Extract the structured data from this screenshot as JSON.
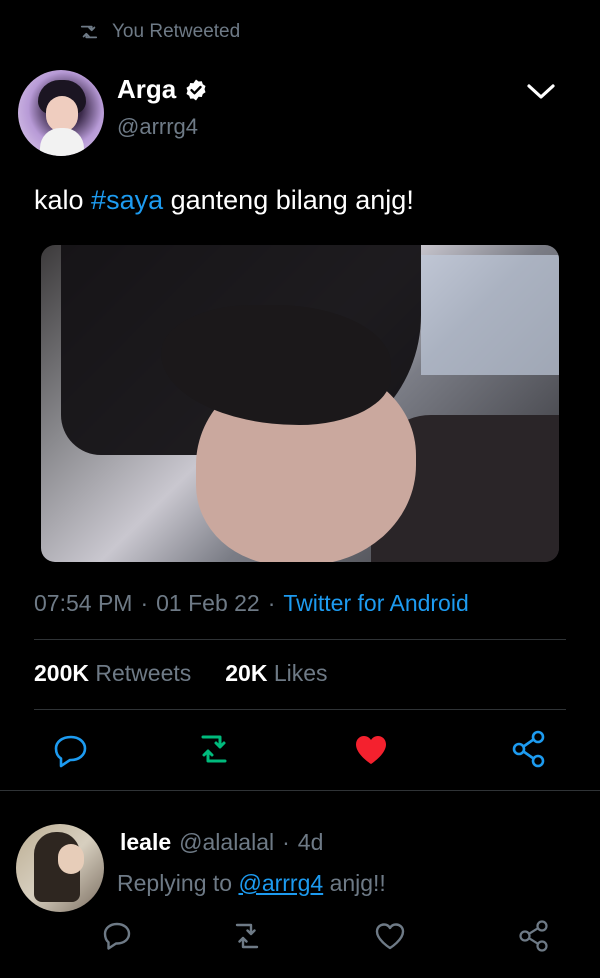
{
  "retweet_banner": {
    "label": "You Retweeted"
  },
  "tweet": {
    "author_name": "Arga",
    "author_handle": "@arrrg4",
    "text_before": "kalo ",
    "hashtag": "#saya",
    "text_after": " ganteng bilang anjg!",
    "time": "07:54 PM",
    "dot1": "·",
    "date": "01 Feb 22",
    "dot2": "·",
    "source": "Twitter for Android",
    "retweets_count": "200K",
    "retweets_label": "Retweets",
    "likes_count": "20K",
    "likes_label": "Likes"
  },
  "reply": {
    "author_name": "leale",
    "author_handle": "@alalalal",
    "dot": "·",
    "age": "4d",
    "replying_to_label": "Replying to",
    "replying_to_handle": "@arrrg4",
    "text": "anjg!!"
  },
  "colors": {
    "background": "#000000",
    "muted": "#6e7a86",
    "link": "#1d9bf0",
    "retweet_active": "#00ba7c",
    "like_active": "#f91880"
  },
  "icons": {
    "retweet_banner": "retweet-icon",
    "verified": "verified-badge-icon",
    "menu": "chevron-down-icon",
    "reply": "reply-icon",
    "retweet": "retweet-icon",
    "like": "heart-icon",
    "share": "share-icon"
  }
}
